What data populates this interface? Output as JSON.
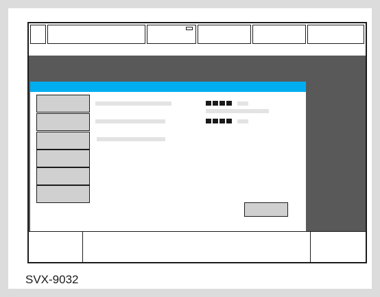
{
  "caption": "SVX-9032",
  "colors": {
    "background": "#dcdcdc",
    "panel": "#ffffff",
    "frame": "#1a1a1a",
    "workarea": "#595959",
    "titlebar": "#00aeef",
    "button_fill": "#d0d0d0",
    "placeholder_line": "#e3e3e3"
  },
  "topbar_cells": [
    "",
    "",
    "",
    "",
    "",
    ""
  ],
  "nav_buttons": [
    "",
    "",
    "",
    "",
    "",
    ""
  ],
  "ok_button": ""
}
